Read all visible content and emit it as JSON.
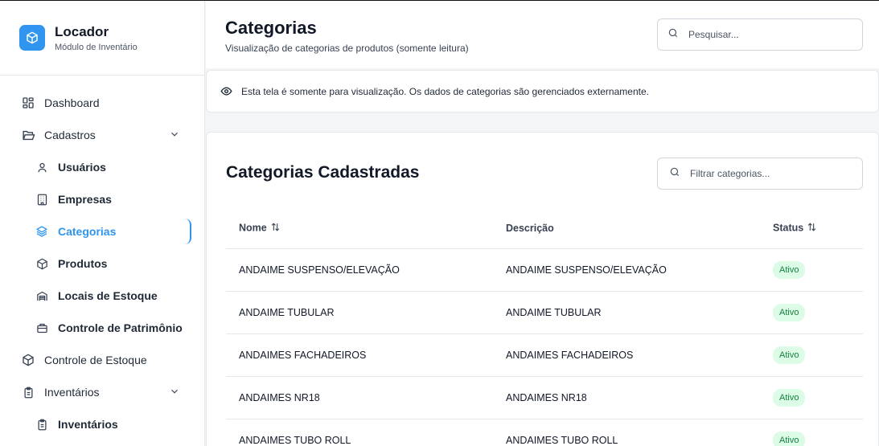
{
  "brand": {
    "title": "Locador",
    "subtitle": "Módulo de Inventário"
  },
  "sidebar": {
    "items": [
      {
        "label": "Dashboard",
        "icon": "dashboard-icon"
      },
      {
        "label": "Cadastros",
        "icon": "folder-open-icon"
      },
      {
        "label": "Usuários",
        "icon": "user-icon"
      },
      {
        "label": "Empresas",
        "icon": "building-icon"
      },
      {
        "label": "Categorias",
        "icon": "layers-icon"
      },
      {
        "label": "Produtos",
        "icon": "package-icon"
      },
      {
        "label": "Locais de Estoque",
        "icon": "warehouse-icon"
      },
      {
        "label": "Controle de Patrimônio",
        "icon": "briefcase-icon"
      },
      {
        "label": "Controle de Estoque",
        "icon": "box-icon"
      },
      {
        "label": "Inventários",
        "icon": "clipboard-icon"
      },
      {
        "label": "Inventários",
        "icon": "clipboard-icon"
      }
    ]
  },
  "header": {
    "title": "Categorias",
    "subtitle": "Visualização de categorias de produtos (somente leitura)",
    "search_placeholder": "Pesquisar..."
  },
  "notice": {
    "text": "Esta tela é somente para visualização. Os dados de categorias são gerenciados externamente."
  },
  "card": {
    "title": "Categorias Cadastradas",
    "filter_placeholder": "Filtrar categorias...",
    "columns": [
      "Nome",
      "Descrição",
      "Status"
    ],
    "rows": [
      {
        "nome": "ANDAIME SUSPENSO/ELEVAÇÃO",
        "descricao": "ANDAIME SUSPENSO/ELEVAÇÃO",
        "status": "Ativo"
      },
      {
        "nome": "ANDAIME TUBULAR",
        "descricao": "ANDAIME TUBULAR",
        "status": "Ativo"
      },
      {
        "nome": "ANDAIMES FACHADEIROS",
        "descricao": "ANDAIMES FACHADEIROS",
        "status": "Ativo"
      },
      {
        "nome": "ANDAIMES NR18",
        "descricao": "ANDAIMES NR18",
        "status": "Ativo"
      },
      {
        "nome": "ANDAIMES TUBO ROLL",
        "descricao": "ANDAIMES TUBO ROLL",
        "status": "Ativo"
      }
    ]
  },
  "colors": {
    "accent": "#2f95ee",
    "badge_bg": "#dcfce7",
    "badge_text": "#15803d"
  }
}
